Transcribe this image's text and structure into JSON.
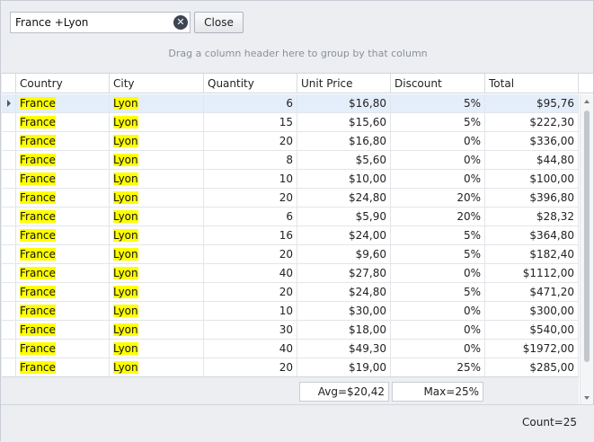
{
  "search": {
    "value": "France +Lyon"
  },
  "toolbar": {
    "close_label": "Close",
    "clear_glyph": "✕"
  },
  "group_hint": "Drag a column header here to group by that column",
  "columns": [
    "Country",
    "City",
    "Quantity",
    "Unit Price",
    "Discount",
    "Total"
  ],
  "rows": [
    {
      "country": "France",
      "city": "Lyon",
      "quantity": "6",
      "unit_price": "$16,80",
      "discount": "5%",
      "total": "$95,76"
    },
    {
      "country": "France",
      "city": "Lyon",
      "quantity": "15",
      "unit_price": "$15,60",
      "discount": "5%",
      "total": "$222,30"
    },
    {
      "country": "France",
      "city": "Lyon",
      "quantity": "20",
      "unit_price": "$16,80",
      "discount": "0%",
      "total": "$336,00"
    },
    {
      "country": "France",
      "city": "Lyon",
      "quantity": "8",
      "unit_price": "$5,60",
      "discount": "0%",
      "total": "$44,80"
    },
    {
      "country": "France",
      "city": "Lyon",
      "quantity": "10",
      "unit_price": "$10,00",
      "discount": "0%",
      "total": "$100,00"
    },
    {
      "country": "France",
      "city": "Lyon",
      "quantity": "20",
      "unit_price": "$24,80",
      "discount": "20%",
      "total": "$396,80"
    },
    {
      "country": "France",
      "city": "Lyon",
      "quantity": "6",
      "unit_price": "$5,90",
      "discount": "20%",
      "total": "$28,32"
    },
    {
      "country": "France",
      "city": "Lyon",
      "quantity": "16",
      "unit_price": "$24,00",
      "discount": "5%",
      "total": "$364,80"
    },
    {
      "country": "France",
      "city": "Lyon",
      "quantity": "20",
      "unit_price": "$9,60",
      "discount": "5%",
      "total": "$182,40"
    },
    {
      "country": "France",
      "city": "Lyon",
      "quantity": "40",
      "unit_price": "$27,80",
      "discount": "0%",
      "total": "$1112,00"
    },
    {
      "country": "France",
      "city": "Lyon",
      "quantity": "20",
      "unit_price": "$24,80",
      "discount": "5%",
      "total": "$471,20"
    },
    {
      "country": "France",
      "city": "Lyon",
      "quantity": "10",
      "unit_price": "$30,00",
      "discount": "0%",
      "total": "$300,00"
    },
    {
      "country": "France",
      "city": "Lyon",
      "quantity": "30",
      "unit_price": "$18,00",
      "discount": "0%",
      "total": "$540,00"
    },
    {
      "country": "France",
      "city": "Lyon",
      "quantity": "40",
      "unit_price": "$49,30",
      "discount": "0%",
      "total": "$1972,00"
    },
    {
      "country": "France",
      "city": "Lyon",
      "quantity": "20",
      "unit_price": "$19,00",
      "discount": "25%",
      "total": "$285,00"
    }
  ],
  "summary": {
    "unit_price": "Avg=$20,42",
    "discount": "Max=25%"
  },
  "status": {
    "count": "Count=25"
  },
  "colors": {
    "highlight": "#ffff00",
    "selected_row": "#e4eefb"
  }
}
